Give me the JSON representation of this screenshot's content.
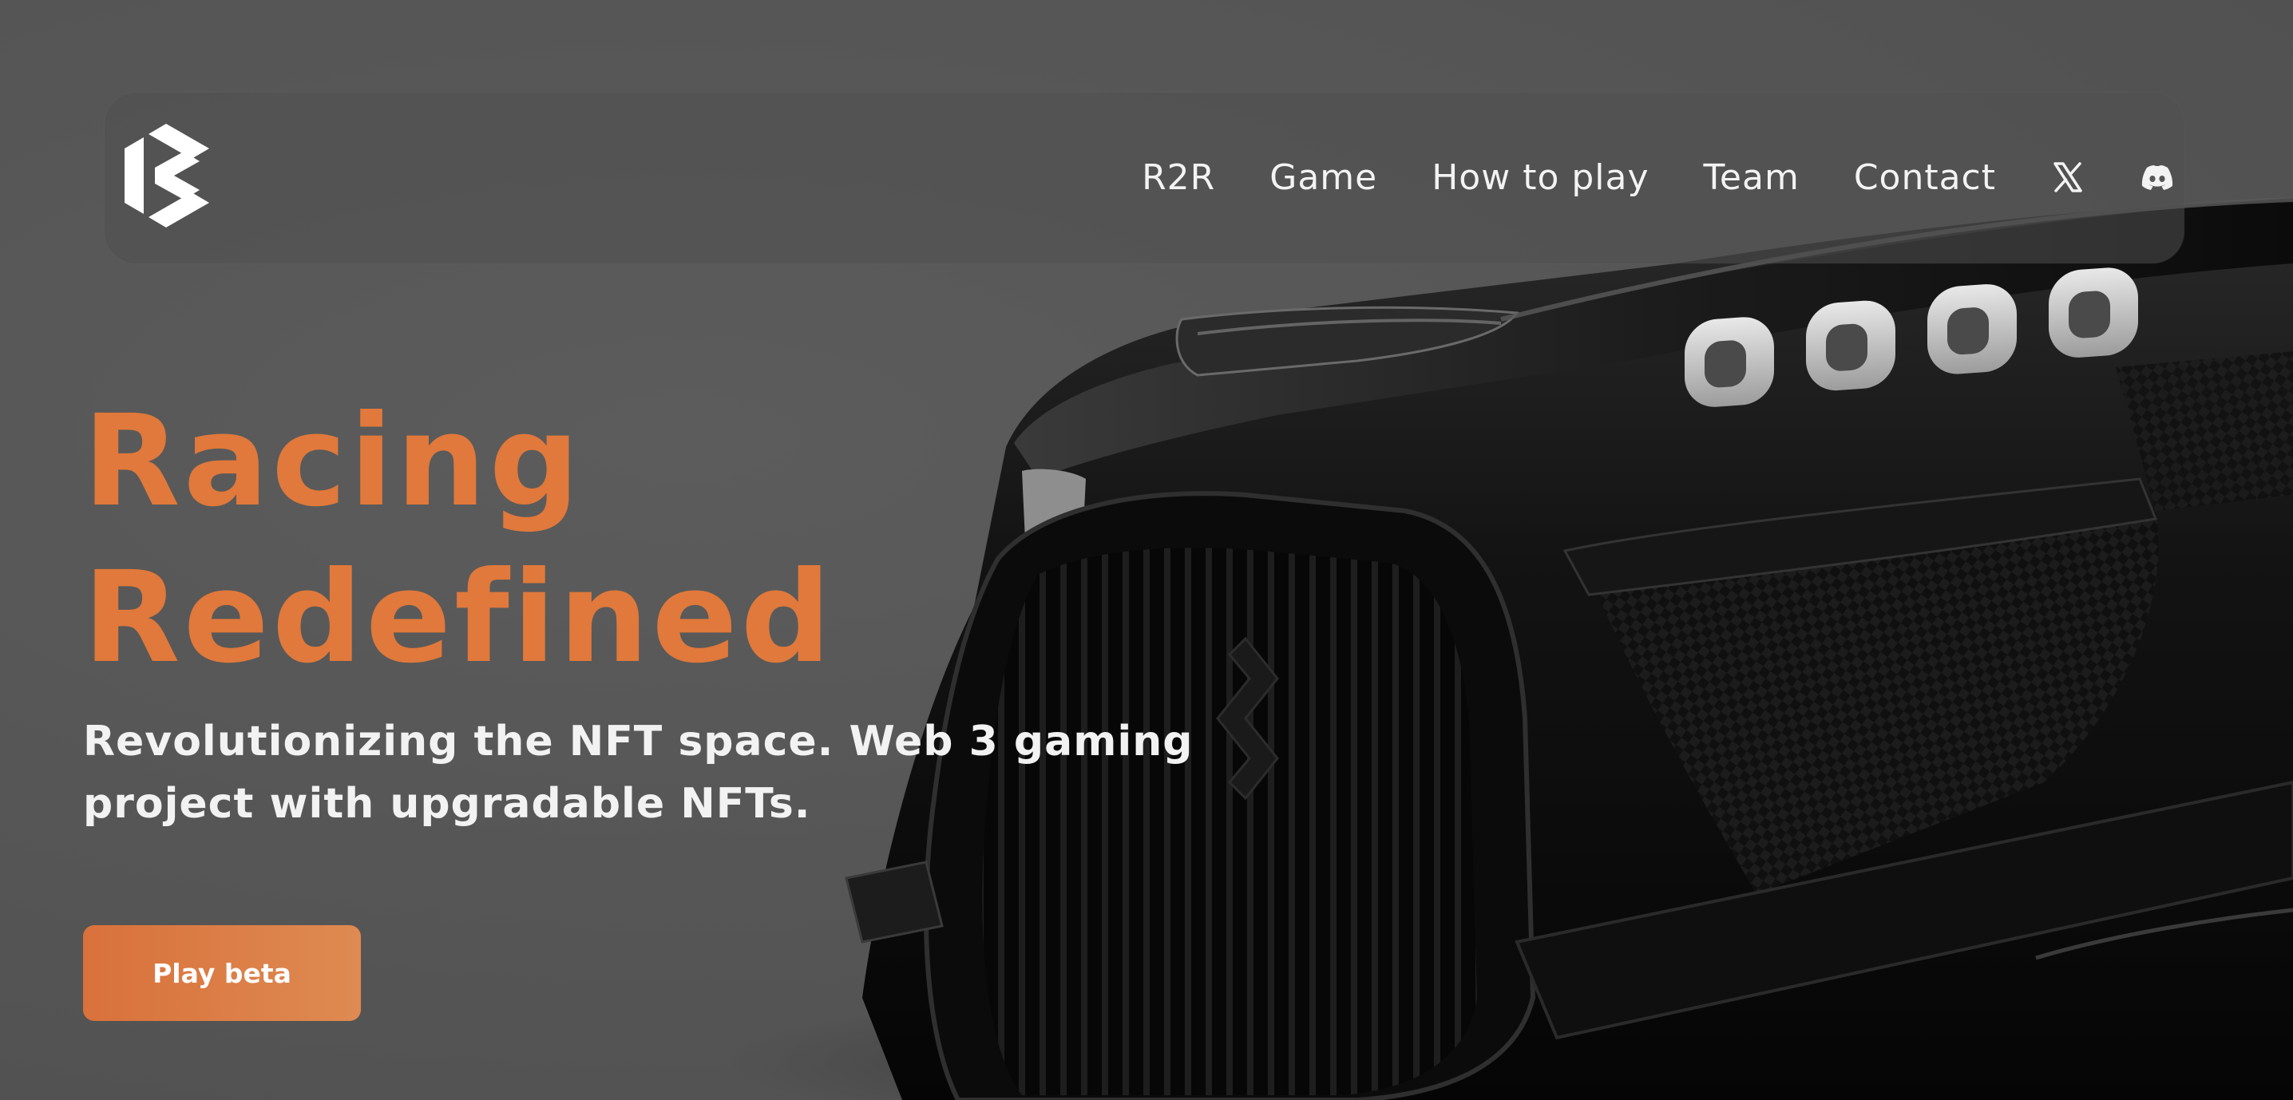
{
  "nav": {
    "links": [
      {
        "label": "R2R"
      },
      {
        "label": "Game"
      },
      {
        "label": "How to play"
      },
      {
        "label": "Team"
      },
      {
        "label": "Contact"
      }
    ],
    "social_icons": [
      "x-icon",
      "discord-icon"
    ]
  },
  "hero": {
    "title_line1": "Racing",
    "title_line2": "Redefined",
    "subtitle": "Revolutionizing the NFT space. Web 3 gaming project with upgradable NFTs.",
    "cta_label": "Play beta"
  },
  "colors": {
    "background": "#575757",
    "accent": "#e0793b",
    "text": "#f2f2f2"
  }
}
